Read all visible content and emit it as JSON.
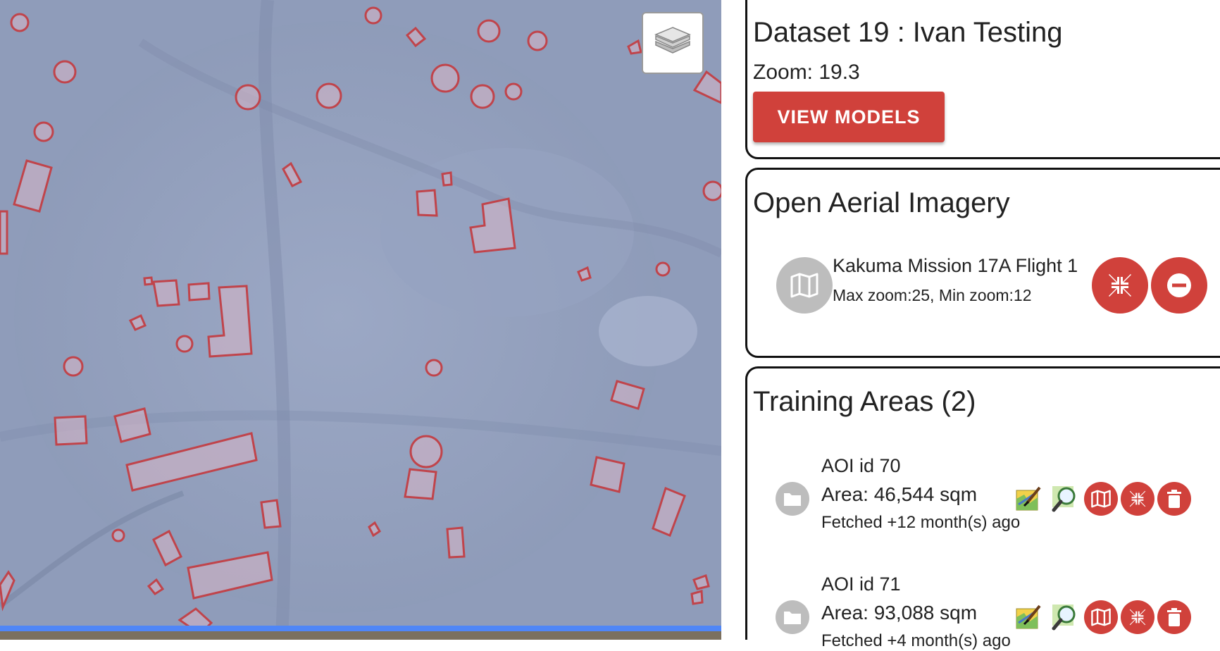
{
  "map": {
    "layers_button_icon": "layers-icon",
    "polygon_stroke": "#c0444b",
    "polygon_fill": "#d9b7c6"
  },
  "dataset": {
    "title": "Dataset 19 : Ivan Testing",
    "zoom": "Zoom: 19.3",
    "view_models_label": "VIEW MODELS"
  },
  "imagery": {
    "section_title": "Open Aerial Imagery",
    "name": "Kakuma Mission 17A Flight 1",
    "zoom_range": "Max zoom:25, Min zoom:12",
    "icon": "map-icon",
    "actions": [
      "fit-bounds-icon",
      "remove-icon"
    ]
  },
  "training": {
    "section_title": "Training Areas (2)",
    "items": [
      {
        "id_label": "AOI id 70",
        "area": "Area: 46,544 sqm",
        "fetched": "Fetched +12 month(s) ago"
      },
      {
        "id_label": "AOI id 71",
        "area": "Area: 93,088 sqm",
        "fetched": "Fetched +4 month(s) ago"
      }
    ],
    "item_actions": [
      "josm-edit-icon",
      "zoom-in-icon",
      "map-icon",
      "fit-bounds-icon",
      "delete-icon"
    ]
  },
  "colors": {
    "accent": "#d0413b",
    "avatar_bg": "#bdbdbd"
  }
}
